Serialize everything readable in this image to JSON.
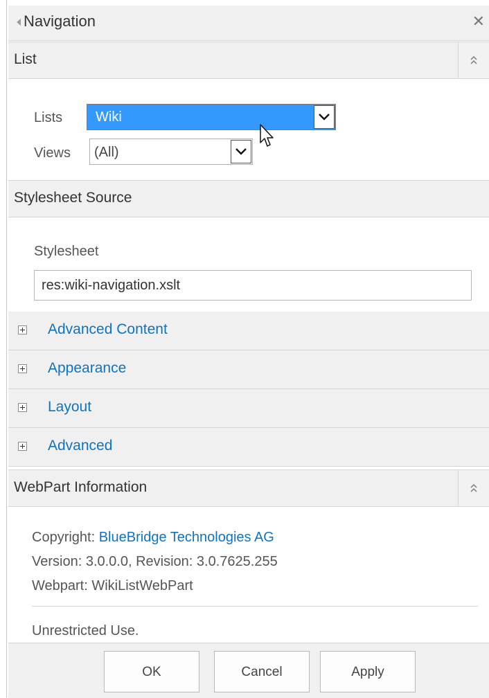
{
  "panel": {
    "title": "Navigation"
  },
  "list_section": {
    "header": "List",
    "lists_label": "Lists",
    "lists_value": "Wiki",
    "views_label": "Views",
    "views_value": "(All)"
  },
  "stylesheet_section": {
    "header": "Stylesheet Source",
    "stylesheet_label": "Stylesheet",
    "stylesheet_value": "res:wiki-navigation.xslt"
  },
  "expanders": [
    {
      "label": "Advanced Content"
    },
    {
      "label": "Appearance"
    },
    {
      "label": "Layout"
    },
    {
      "label": "Advanced"
    }
  ],
  "info_section": {
    "header": "WebPart Information",
    "copyright_label": "Copyright: ",
    "copyright_value": "BlueBridge Technologies AG",
    "version": "Version: 3.0.0.0, Revision: 3.0.7625.255",
    "webpart": "Webpart: WikiListWebPart",
    "license": "Unrestricted Use."
  },
  "footer": {
    "ok": "OK",
    "cancel": "Cancel",
    "apply": "Apply"
  },
  "colors": {
    "accent_link": "#0f73c2",
    "selection": "#3399ff",
    "header_bg": "#f0f0f0"
  },
  "icons": {
    "back": "left-triangle-icon",
    "close": "close-icon",
    "collapse": "double-chevron-up-icon",
    "dropdown": "chevron-down-icon",
    "expand": "plus-box-icon",
    "cursor": "mouse-pointer-icon"
  }
}
